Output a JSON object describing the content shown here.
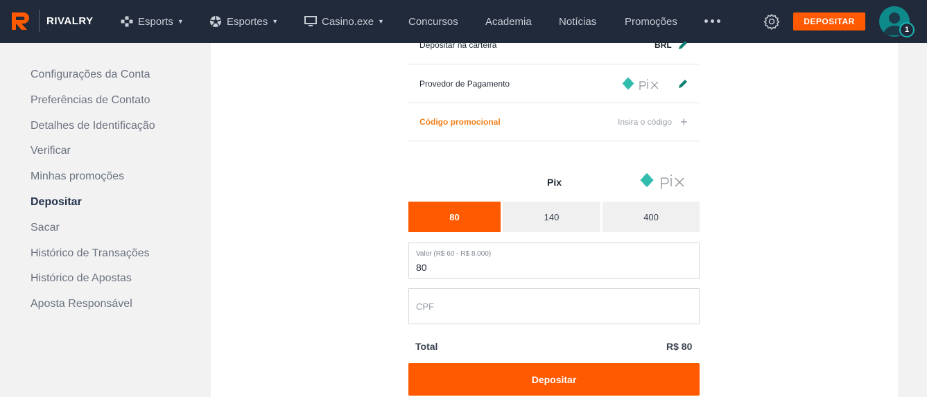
{
  "header": {
    "brand": "RIVALRY",
    "nav": [
      {
        "label": "Esports",
        "icon": "gamepad-icon",
        "caret": true
      },
      {
        "label": "Esportes",
        "icon": "ball-icon",
        "caret": true
      },
      {
        "label": "Casino.exe",
        "icon": "monitor-icon",
        "caret": true
      },
      {
        "label": "Concursos"
      },
      {
        "label": "Academia"
      },
      {
        "label": "Notícias"
      },
      {
        "label": "Promoções"
      }
    ],
    "deposit_button": "DEPOSITAR",
    "notification_count": "1"
  },
  "sidebar": {
    "items": [
      {
        "label": "Configurações da Conta"
      },
      {
        "label": "Preferências de Contato"
      },
      {
        "label": "Detalhes de Identificação"
      },
      {
        "label": "Verificar"
      },
      {
        "label": "Minhas promoções"
      },
      {
        "label": "Depositar",
        "active": true
      },
      {
        "label": "Sacar"
      },
      {
        "label": "Histórico de Transações"
      },
      {
        "label": "Histórico de Apostas"
      },
      {
        "label": "Aposta Responsável"
      }
    ]
  },
  "deposit": {
    "wallet_label": "Depositar na carteira",
    "wallet_currency": "BRL",
    "provider_label": "Provedor de Pagamento",
    "promo_label": "Código promocional",
    "promo_placeholder": "Insira o código",
    "method_title": "Pix",
    "amounts": [
      "80",
      "140",
      "400"
    ],
    "selected_amount": "80",
    "value_label": "Valor (R$ 60 - R$ 8.000)",
    "value": "80",
    "cpf_placeholder": "CPF",
    "total_label": "Total",
    "total_value": "R$ 80",
    "submit": "Depositar"
  },
  "colors": {
    "accent": "#ff5a00",
    "header_bg": "#202a3a",
    "pix_teal": "#32bcad",
    "promo_orange": "#f07f1a"
  }
}
